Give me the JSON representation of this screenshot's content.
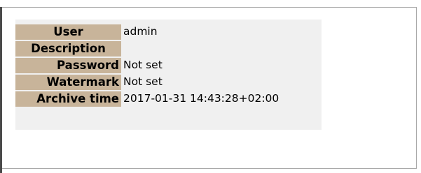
{
  "properties": [
    {
      "label": "User",
      "value": "admin"
    },
    {
      "label": "Description",
      "value": ""
    },
    {
      "label": "Password",
      "value": "Not set"
    },
    {
      "label": "Watermark",
      "value": "Not set"
    },
    {
      "label": "Archive time",
      "value": "2017-01-31 14:43:28+02:00"
    }
  ],
  "colors": {
    "label_background": "#c8b49a",
    "table_background": "#f0f0f0",
    "frame_border": "#a9a9a9"
  }
}
